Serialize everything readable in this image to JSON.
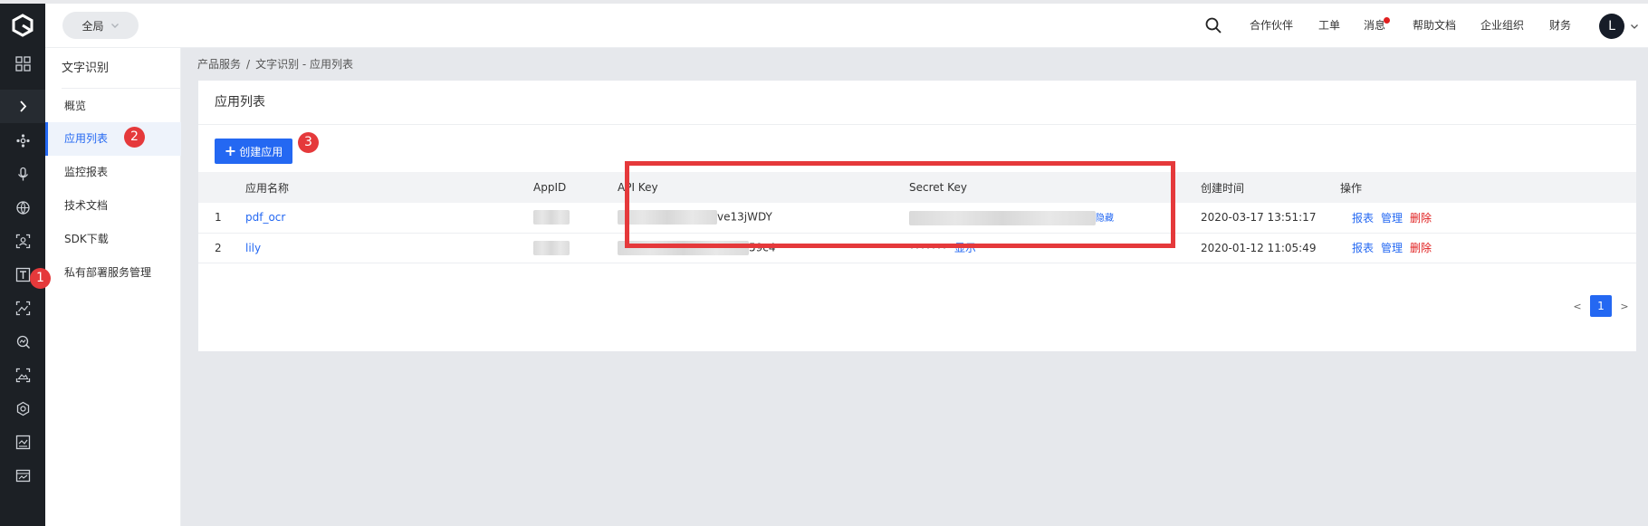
{
  "header": {
    "region_label": "全局",
    "nav_items": [
      "合作伙伴",
      "工单",
      "消息",
      "帮助文档",
      "企业组织",
      "财务"
    ],
    "avatar_letter": "L"
  },
  "rail_icons": [
    "logo-icon",
    "grid-icon",
    "expand-icon",
    "nodes-icon",
    "microphone-icon",
    "globe-icon",
    "face-scan-icon",
    "text-ocr-icon",
    "image-recognition-icon",
    "image-search-icon",
    "landscape-icon",
    "hexagon-icon",
    "image-audit-icon",
    "image-process-icon"
  ],
  "sidebar": {
    "title": "文字识别",
    "items": [
      {
        "label": "概览"
      },
      {
        "label": "应用列表",
        "active": true
      },
      {
        "label": "监控报表"
      },
      {
        "label": "技术文档"
      },
      {
        "label": "SDK下载"
      },
      {
        "label": "私有部署服务管理"
      }
    ]
  },
  "breadcrumb": {
    "parent": "产品服务",
    "separator": "/",
    "current": "文字识别 - 应用列表"
  },
  "card": {
    "title": "应用列表",
    "create_button": "创建应用"
  },
  "table": {
    "columns": [
      "应用名称",
      "AppID",
      "API Key",
      "Secret Key",
      "创建时间",
      "操作"
    ],
    "rows": [
      {
        "index": "1",
        "name": "pdf_ocr",
        "api_key_suffix": "ve13jWDY",
        "secret_visible": "",
        "secret_action": "隐藏",
        "created": "2020-03-17 13:51:17",
        "ops": [
          "报表",
          "管理",
          "删除"
        ]
      },
      {
        "index": "2",
        "name": "lily",
        "api_key_suffix": "59c4",
        "secret_visible": "*******",
        "secret_action": "显示",
        "created": "2020-01-12 11:05:49",
        "ops": [
          "报表",
          "管理",
          "删除"
        ]
      }
    ]
  },
  "pagination": {
    "prev": "<",
    "current": "1",
    "next": ">"
  },
  "annotations": {
    "badge_1": "1",
    "badge_2": "2",
    "badge_3": "3",
    "highlight_color": "#e5393b"
  },
  "colors": {
    "accent": "#2468f2",
    "danger": "#e02020",
    "rail_bg": "#1c2025",
    "page_bg": "#e6e8ec"
  }
}
